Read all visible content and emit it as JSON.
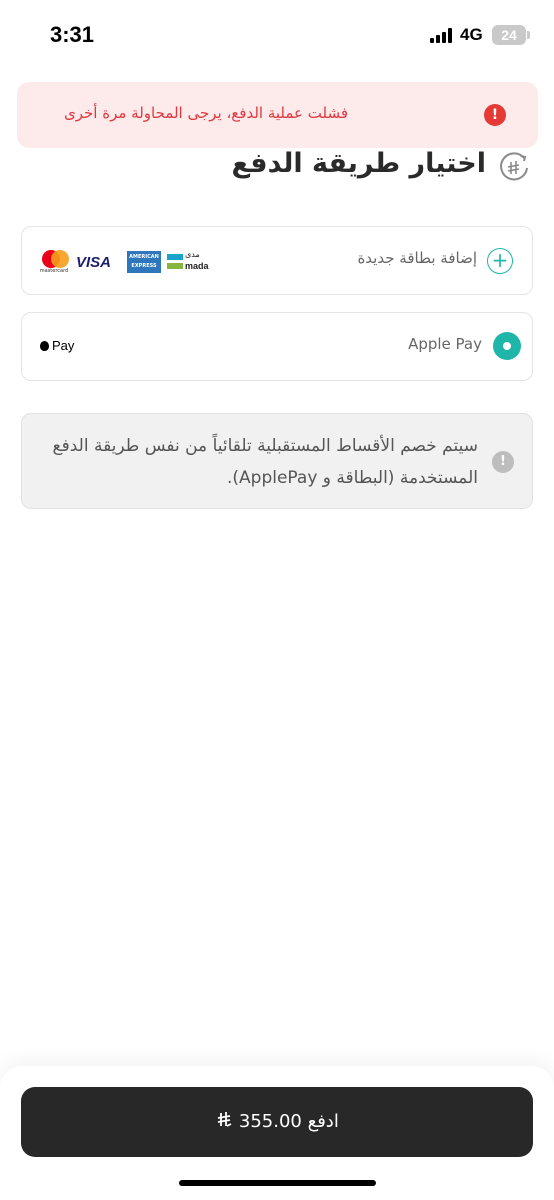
{
  "status_bar": {
    "time": "3:31",
    "network": "4G",
    "battery": "24"
  },
  "error_toast": {
    "message": "فشلت عملية الدفع، يرجى المحاولة مرة أخرى",
    "icon": "exclamation-icon",
    "color": "#e53935"
  },
  "header": {
    "title": "اختيار طريقة الدفع",
    "back_icon": "riyal-back-icon"
  },
  "payment_methods": {
    "new_card": {
      "label": "إضافة بطاقة جديدة",
      "icon": "plus-circle-icon"
    },
    "brands": {
      "mastercard": "mastercard",
      "visa": "VISA",
      "amex_line1": "AMERICAN",
      "amex_line2": "EXPRESS",
      "mada_ar": "مدى",
      "mada_en": "mada"
    },
    "apple_pay": {
      "label": "Apple Pay",
      "logo_text": "Pay",
      "selected": true
    }
  },
  "info": {
    "message": "سيتم خصم الأقساط المستقبلية تلقائياً من نفس طريقة الدفع المستخدمة (البطاقة و ApplePay).",
    "icon": "exclamation-icon"
  },
  "footer": {
    "pay_label": "ادفع",
    "amount": "355.00",
    "accent": "#1fb5a8"
  }
}
